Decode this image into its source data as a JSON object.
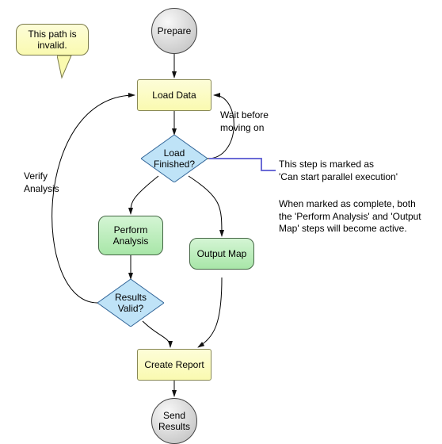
{
  "nodes": {
    "prepare": "Prepare",
    "load_data": "Load Data",
    "load_finished": "Load\nFinished?",
    "perform_analysis": "Perform\nAnalysis",
    "output_map": "Output Map",
    "results_valid": "Results\nValid?",
    "create_report": "Create Report",
    "send_results": "Send\nResults"
  },
  "edge_labels": {
    "wait": "Wait before\nmoving on",
    "verify": "Verify\nAnalysis"
  },
  "callout": {
    "text": "This path is\ninvalid."
  },
  "annotations": {
    "parallel_heading": "This step is marked as\n'Can start parallel execution'",
    "parallel_body": "When marked as complete, both\nthe 'Perform Analysis' and 'Output\nMap' steps will become active."
  },
  "chart_data": {
    "type": "flowchart",
    "nodes": [
      {
        "id": "prepare",
        "label": "Prepare",
        "shape": "terminal"
      },
      {
        "id": "load_data",
        "label": "Load Data",
        "shape": "process"
      },
      {
        "id": "load_finished",
        "label": "Load Finished?",
        "shape": "decision"
      },
      {
        "id": "perform_analysis",
        "label": "Perform Analysis",
        "shape": "process2"
      },
      {
        "id": "output_map",
        "label": "Output Map",
        "shape": "process2"
      },
      {
        "id": "results_valid",
        "label": "Results Valid?",
        "shape": "decision"
      },
      {
        "id": "create_report",
        "label": "Create Report",
        "shape": "process"
      },
      {
        "id": "send_results",
        "label": "Send Results",
        "shape": "terminal"
      }
    ],
    "edges": [
      {
        "from": "prepare",
        "to": "load_data"
      },
      {
        "from": "load_data",
        "to": "load_finished"
      },
      {
        "from": "load_finished",
        "to": "load_data",
        "label": "Wait before moving on"
      },
      {
        "from": "load_finished",
        "to": "perform_analysis"
      },
      {
        "from": "load_finished",
        "to": "output_map"
      },
      {
        "from": "perform_analysis",
        "to": "results_valid"
      },
      {
        "from": "results_valid",
        "to": "create_report"
      },
      {
        "from": "results_valid",
        "to": "load_data",
        "label": "Verify Analysis",
        "note": "This path is invalid."
      },
      {
        "from": "output_map",
        "to": "create_report"
      },
      {
        "from": "create_report",
        "to": "send_results"
      }
    ],
    "annotations": [
      {
        "target": "load_finished",
        "text": "This step is marked as 'Can start parallel execution'. When marked as complete, both the 'Perform Analysis' and 'Output Map' steps will become active."
      }
    ]
  }
}
